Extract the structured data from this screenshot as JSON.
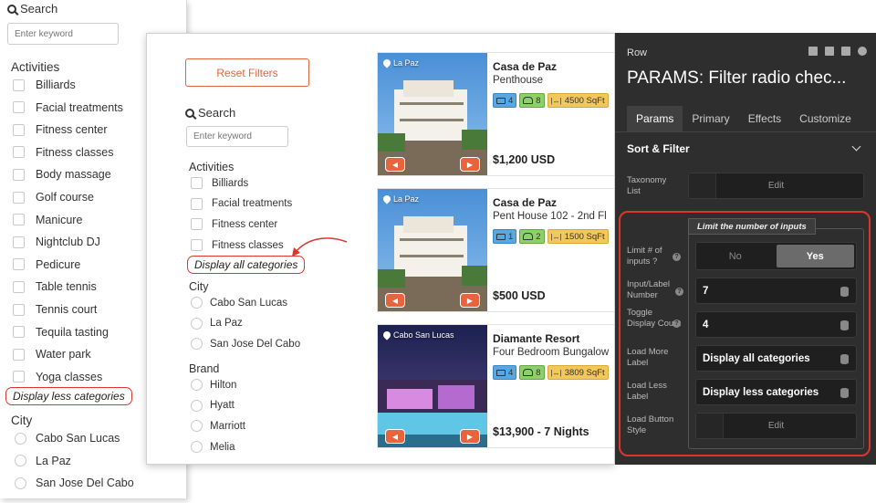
{
  "left_panel": {
    "search_label": "Search",
    "keyword_placeholder": "Enter keyword",
    "activities_title": "Activities",
    "activities": [
      "Billiards",
      "Facial treatments",
      "Fitness center",
      "Fitness classes",
      "Body massage",
      "Golf course",
      "Manicure",
      "Nightclub DJ",
      "Pedicure",
      "Table tennis",
      "Tennis court",
      "Tequila tasting",
      "Water park",
      "Yoga classes"
    ],
    "toggle_label": "Display less categories",
    "city_title": "City",
    "cities": [
      "Cabo San Lucas",
      "La Paz",
      "San Jose Del Cabo"
    ]
  },
  "middle_panel": {
    "reset_label": "Reset Filters",
    "search_label": "Search",
    "keyword_placeholder": "Enter keyword",
    "activities_title": "Activities",
    "activities": [
      "Billiards",
      "Facial treatments",
      "Fitness center",
      "Fitness classes"
    ],
    "toggle_label": "Display all categories",
    "city_title": "City",
    "cities": [
      "Cabo San Lucas",
      "La Paz",
      "San Jose Del Cabo"
    ],
    "brand_title": "Brand",
    "brands": [
      "Hilton",
      "Hyatt",
      "Marriott",
      "Melia"
    ],
    "listings": [
      {
        "location": "La Paz",
        "title": "Casa de Paz",
        "subtitle": "Penthouse",
        "beds": "4",
        "guests": "8",
        "size": "4500 SqFt",
        "price": "$1,200 USD"
      },
      {
        "location": "La Paz",
        "title": "Casa de Paz",
        "subtitle": "Pent House 102 - 2nd Fl",
        "beds": "1",
        "guests": "2",
        "size": "1500 SqFt",
        "price": "$500 USD"
      },
      {
        "location": "Cabo San Lucas",
        "title": "Diamante Resort",
        "subtitle": "Four Bedroom Bungalow",
        "beds": "4",
        "guests": "8",
        "size": "3809 SqFt",
        "price": "$13,900 - 7 Nights"
      }
    ]
  },
  "right_panel": {
    "row_label": "Row",
    "title": "PARAMS: Filter radio chec...",
    "tabs": [
      "Params",
      "Primary",
      "Effects",
      "Customize"
    ],
    "section": "Sort & Filter",
    "taxonomy_label": "Taxonomy List",
    "edit_label": "Edit",
    "group_title": "Limit the number of inputs",
    "limit_label": "Limit # of inputs ?",
    "limit_options": [
      "No",
      "Yes"
    ],
    "input_number_label": "Input/Label Number",
    "input_number_value": "7",
    "toggle_count_label": "Toggle Display Count",
    "toggle_count_value": "4",
    "load_more_label": "Load More Label",
    "load_more_value": "Display all categories",
    "load_less_label": "Load Less Label",
    "load_less_value": "Display less categories",
    "load_button_label": "Load Button Style",
    "load_button_edit": "Edit"
  },
  "colors": {
    "accent": "#e8643c",
    "highlight": "#d9372c",
    "panel_dark": "#2e2e2e"
  }
}
